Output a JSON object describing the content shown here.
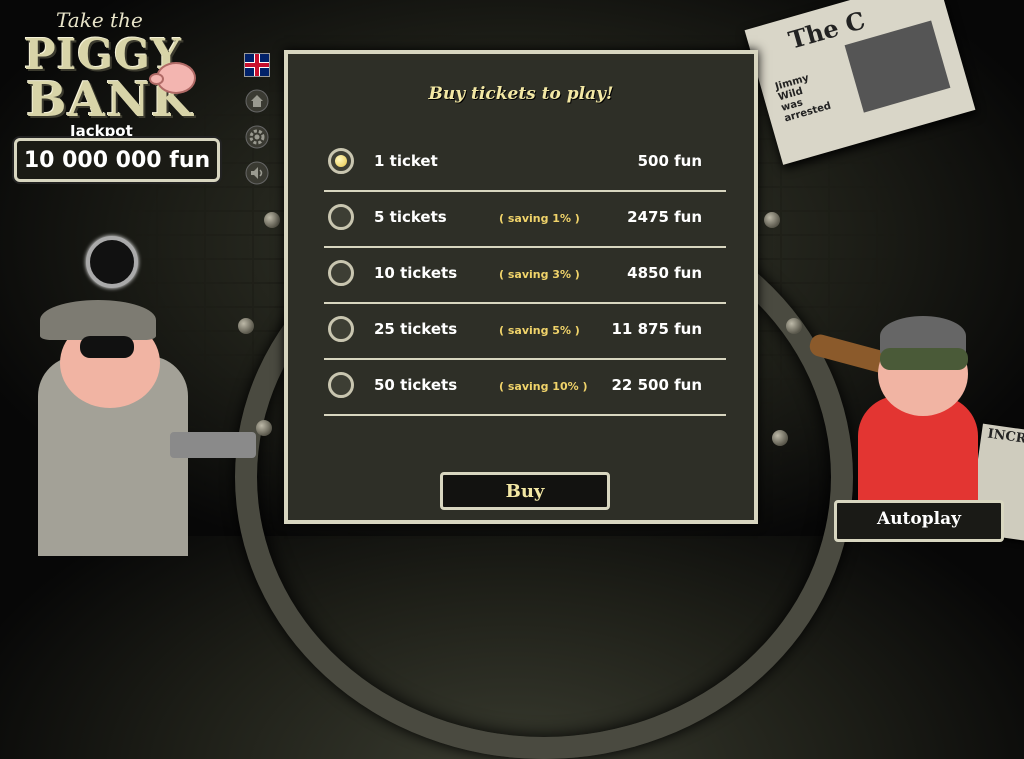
{
  "logo": {
    "take": "Take the",
    "piggy": "PIGGY",
    "bank": "BANK",
    "jackpot_label": "Jackpot",
    "jackpot_value": "10 000 000 fun"
  },
  "side_icons": [
    "uk-flag-icon",
    "home-icon",
    "gear-icon",
    "speaker-icon"
  ],
  "newspaper": {
    "masthead": "The C",
    "headline": "Jimmy Wild was arrested"
  },
  "newspaper2": {
    "text": "INCRE"
  },
  "panel": {
    "title": "Buy tickets to play!",
    "options": [
      {
        "label": "1 ticket",
        "saving": "",
        "price": "500 fun",
        "selected": true
      },
      {
        "label": "5 tickets",
        "saving": "( saving 1% )",
        "price": "2475 fun",
        "selected": false
      },
      {
        "label": "10 tickets",
        "saving": "( saving 3% )",
        "price": "4850 fun",
        "selected": false
      },
      {
        "label": "25 tickets",
        "saving": "( saving 5% )",
        "price": "11 875 fun",
        "selected": false
      },
      {
        "label": "50 tickets",
        "saving": "( saving 10% )",
        "price": "22 500 fun",
        "selected": false
      }
    ],
    "buy_label": "Buy"
  },
  "autoplay_label": "Autoplay",
  "colors": {
    "panel_bg": "#2e2f27",
    "border": "#d8d6c0",
    "title": "#f3e8a4",
    "saving": "#f0d36a"
  }
}
